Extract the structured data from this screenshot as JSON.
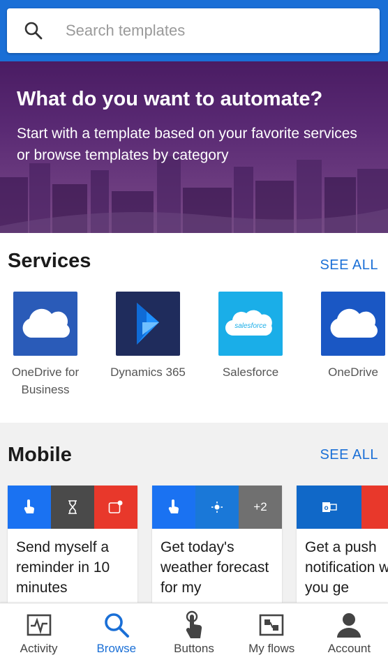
{
  "search": {
    "placeholder": "Search templates",
    "value": ""
  },
  "hero": {
    "title": "What do you want to automate?",
    "subtitle": "Start with a template based on your favorite services or browse templates by category"
  },
  "services": {
    "title": "Services",
    "see_all": "SEE ALL",
    "items": [
      {
        "label": "OneDrive for Business",
        "icon": "onedrive-cloud-icon",
        "color": "#2a5bb8"
      },
      {
        "label": "Dynamics 365",
        "icon": "dynamics-icon",
        "color": "#1f2c5c"
      },
      {
        "label": "Salesforce",
        "icon": "salesforce-icon",
        "color": "#1aaee8"
      },
      {
        "label": "OneDrive",
        "icon": "onedrive-cloud-icon",
        "color": "#1a57c4"
      }
    ]
  },
  "mobile": {
    "title": "Mobile",
    "see_all": "SEE ALL",
    "cards": [
      {
        "title": "Send myself a reminder in 10 minutes",
        "icons": [
          {
            "name": "button-tap-icon",
            "color": "#1a72f2"
          },
          {
            "name": "hourglass-icon",
            "color": "#4a4a4a"
          },
          {
            "name": "notification-icon",
            "color": "#e8382b"
          }
        ]
      },
      {
        "title": "Get today's weather forecast for my",
        "icons": [
          {
            "name": "button-tap-icon",
            "color": "#1a72f2"
          },
          {
            "name": "weather-sun-icon",
            "color": "#1a78d8"
          },
          {
            "name": "more-count",
            "color": "#707070",
            "text": "+2"
          }
        ]
      },
      {
        "title": "Get a push notification when you ge",
        "icons": [
          {
            "name": "outlook-icon",
            "color": "#1068c8"
          },
          {
            "name": "notification-icon",
            "color": "#e8382b"
          }
        ]
      }
    ]
  },
  "nav": {
    "items": [
      {
        "label": "Activity",
        "icon": "activity-icon",
        "active": false
      },
      {
        "label": "Browse",
        "icon": "browse-search-icon",
        "active": true
      },
      {
        "label": "Buttons",
        "icon": "buttons-tap-icon",
        "active": false
      },
      {
        "label": "My flows",
        "icon": "my-flows-icon",
        "active": false
      },
      {
        "label": "Account",
        "icon": "account-icon",
        "active": false
      }
    ]
  },
  "colors": {
    "accent": "#1a6fd6",
    "hero": "#5a2a74"
  }
}
